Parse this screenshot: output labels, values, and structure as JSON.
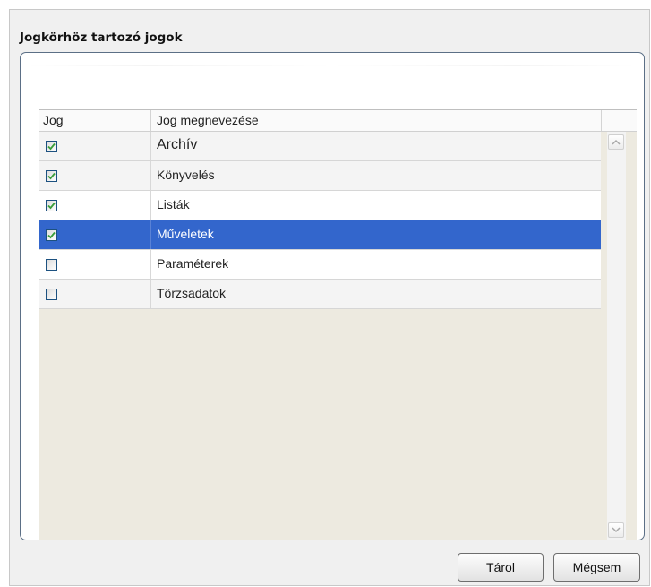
{
  "dialog": {
    "title": "Jogkörhöz tartozó jogok"
  },
  "grid": {
    "columns": [
      "Jog",
      "Jog megnevezése"
    ],
    "rows": [
      {
        "checked": true,
        "name": "Archív",
        "selected": false
      },
      {
        "checked": true,
        "name": "Könyvelés",
        "selected": false
      },
      {
        "checked": true,
        "name": "Listák",
        "selected": false
      },
      {
        "checked": true,
        "name": "Műveletek",
        "selected": true
      },
      {
        "checked": false,
        "name": "Paraméterek",
        "selected": false
      },
      {
        "checked": false,
        "name": "Törzsadatok",
        "selected": false
      }
    ]
  },
  "buttons": {
    "save": "Tárol",
    "cancel": "Mégsem"
  },
  "colors": {
    "selection": "#3366cc",
    "check": "#3a9e3a",
    "panel_border": "#5b6f86",
    "grid_background": "#edeae0"
  },
  "icons": {
    "checkbox_checked": "check-icon",
    "scroll_up": "chevron-up-icon",
    "scroll_down": "chevron-down-icon"
  }
}
